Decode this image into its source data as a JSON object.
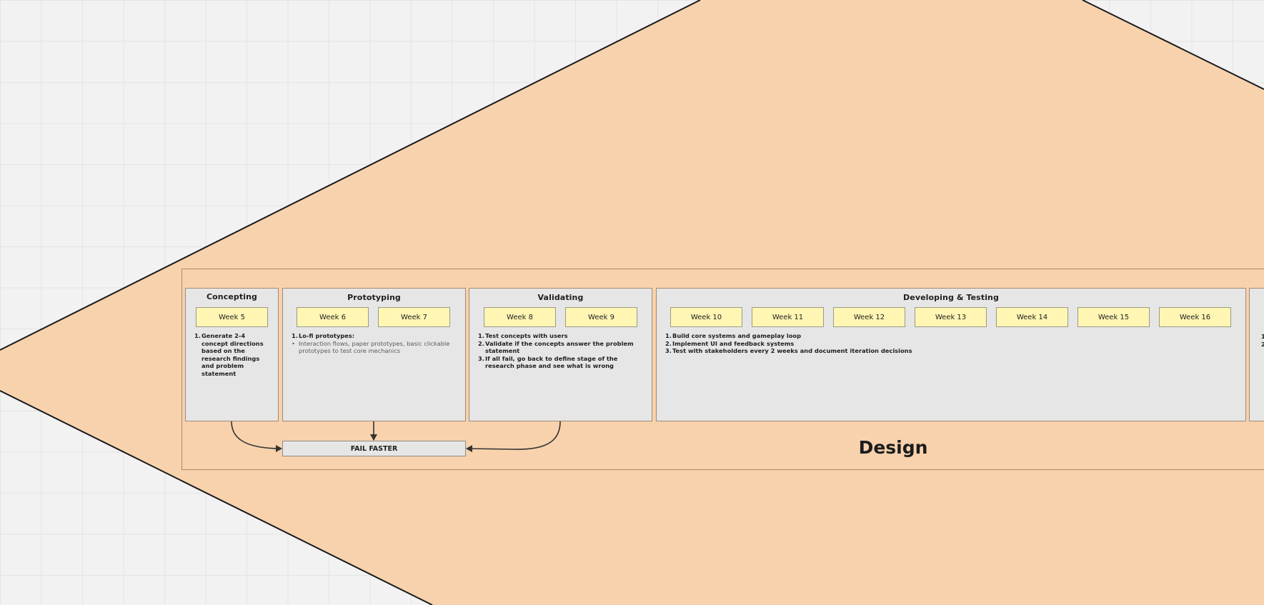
{
  "colors": {
    "canvas": "#f2f2f2",
    "diamond_fill": "#f7d2ad",
    "phase_fill": "#e6e6e6",
    "sticky_fill": "#fff6b3"
  },
  "design_label": "Design",
  "fail_faster_label": "FAIL FASTER",
  "phases": [
    {
      "title": "Concepting",
      "weeks": [
        "Week 5"
      ],
      "tasks": [
        {
          "num": "1.",
          "text": "Generate 2-4 concept directions based on the research findings and problem statement"
        }
      ]
    },
    {
      "title": "Prototyping",
      "weeks": [
        "Week 6",
        "Week 7"
      ],
      "tasks": [
        {
          "num": "1.",
          "text": "Lo-fi prototypes:",
          "sub": "Interaction flows, paper prototypes, basic clickable prototypes to test core mechanics"
        }
      ]
    },
    {
      "title": "Validating",
      "weeks": [
        "Week 8",
        "Week 9"
      ],
      "tasks": [
        {
          "num": "1.",
          "text": "Test concepts with users"
        },
        {
          "num": "2.",
          "text": "Validate if the concepts answer the problem statement"
        },
        {
          "num": "3.",
          "text": "If all fail, go back to define stage of the research phase and see what is wrong"
        }
      ]
    },
    {
      "title": "Developing & Testing",
      "weeks": [
        "Week 10",
        "Week 11",
        "Week 12",
        "Week 13",
        "Week 14",
        "Week 15",
        "Week 16"
      ],
      "tasks": [
        {
          "num": "1.",
          "text": "Build core systems and gameplay loop"
        },
        {
          "num": "2.",
          "text": "Implement UI and feedback systems"
        },
        {
          "num": "3.",
          "text": "Test with stakeholders every 2 weeks and document iteration decisions"
        }
      ]
    },
    {
      "title": "",
      "weeks": [],
      "tasks": [
        {
          "num": "1",
          "text": ""
        },
        {
          "num": "2",
          "text": ""
        }
      ]
    }
  ]
}
